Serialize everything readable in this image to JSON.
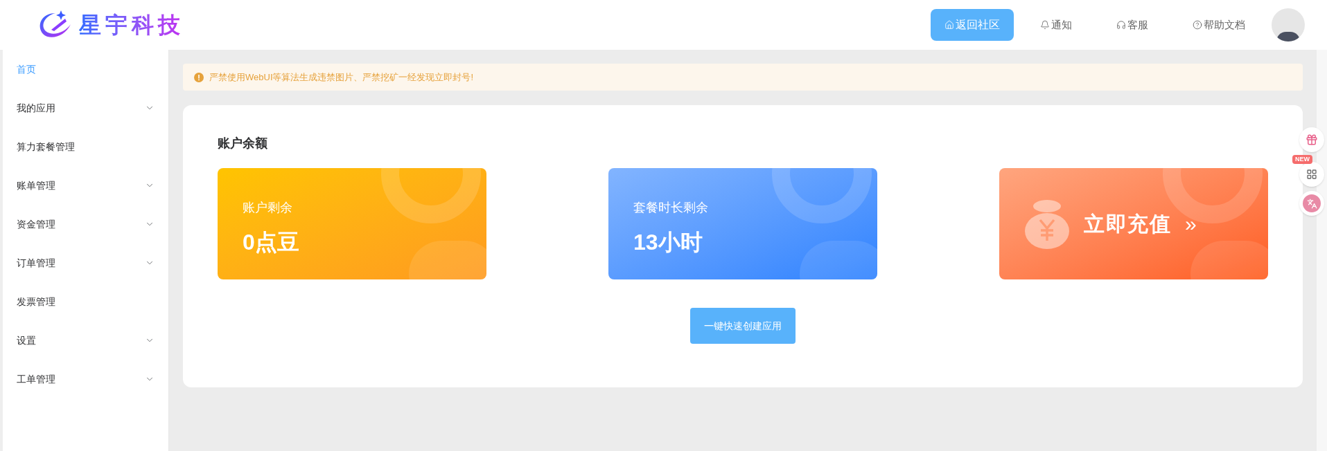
{
  "header": {
    "logo_text": "星宇科技",
    "nav": [
      {
        "label": "返回社区",
        "kind": "primary"
      },
      {
        "label": "通知",
        "kind": "link"
      },
      {
        "label": "客服",
        "kind": "link"
      },
      {
        "label": "帮助文档",
        "kind": "link"
      }
    ]
  },
  "sidebar": {
    "items": [
      {
        "label": "首页",
        "selected": true,
        "expandable": false
      },
      {
        "label": "我的应用",
        "selected": false,
        "expandable": true
      },
      {
        "label": "算力套餐管理",
        "selected": false,
        "expandable": false
      },
      {
        "label": "账单管理",
        "selected": false,
        "expandable": true
      },
      {
        "label": "资金管理",
        "selected": false,
        "expandable": true
      },
      {
        "label": "订单管理",
        "selected": false,
        "expandable": true
      },
      {
        "label": "发票管理",
        "selected": false,
        "expandable": false
      },
      {
        "label": "设置",
        "selected": false,
        "expandable": true
      },
      {
        "label": "工单管理",
        "selected": false,
        "expandable": true
      }
    ]
  },
  "notice": {
    "text": "严禁使用WebUI等算法生成违禁图片、严禁挖矿一经发现立即封号!"
  },
  "balance": {
    "title": "账户余额",
    "cards": [
      {
        "kind": "balance",
        "label": "账户剩余",
        "value": "0点豆"
      },
      {
        "kind": "plan",
        "label": "套餐时长剩余",
        "value": "13小时"
      },
      {
        "kind": "recharge",
        "label": "立即充值",
        "arrow": "»"
      }
    ],
    "create_button": "一键快速创建应用"
  },
  "floating": {
    "badge": "NEW"
  }
}
